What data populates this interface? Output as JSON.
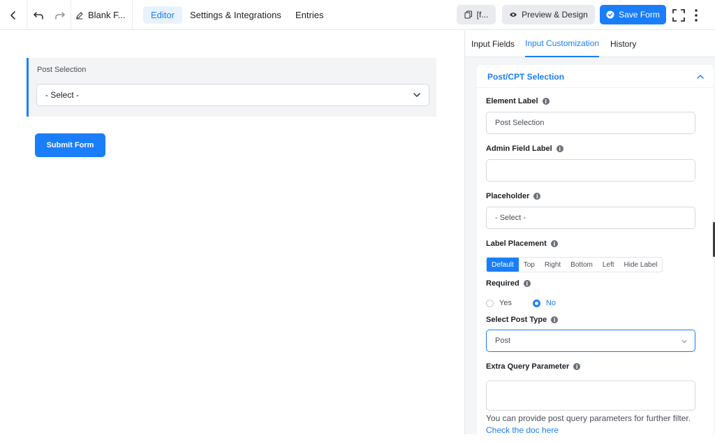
{
  "topbar": {
    "form_title": "Blank F...",
    "tabs": [
      {
        "label": "Editor",
        "active": true
      },
      {
        "label": "Settings & Integrations",
        "active": false
      },
      {
        "label": "Entries",
        "active": false
      }
    ],
    "shortcode_label": "[f...",
    "preview_label": "Preview & Design",
    "save_label": "Save Form",
    "icons": [
      "chevron-left-icon",
      "undo-icon",
      "redo-icon",
      "pencil-icon",
      "copy-icon",
      "eye-icon",
      "check-circle-icon",
      "fullscreen-icon",
      "more-vertical-icon"
    ]
  },
  "canvas": {
    "field_label": "Post Selection",
    "select_value": "- Select -",
    "submit_label": "Submit Form"
  },
  "sidebar": {
    "tabs": [
      {
        "label": "Input Fields",
        "active": false
      },
      {
        "label": "Input Customization",
        "active": true
      },
      {
        "label": "History",
        "active": false
      }
    ],
    "panel_title": "Post/CPT Selection",
    "element_label": {
      "label": "Element Label",
      "value": "Post Selection"
    },
    "admin_label": {
      "label": "Admin Field Label",
      "value": ""
    },
    "placeholder": {
      "label": "Placeholder",
      "value": "- Select -"
    },
    "label_placement": {
      "label": "Label Placement",
      "options": [
        "Default",
        "Top",
        "Right",
        "Bottom",
        "Left",
        "Hide Label"
      ],
      "selected": "Default"
    },
    "required": {
      "label": "Required",
      "options": [
        "Yes",
        "No"
      ],
      "selected": "No"
    },
    "post_type": {
      "label": "Select Post Type",
      "value": "Post"
    },
    "extra_query": {
      "label": "Extra Query Parameter",
      "value": "",
      "help": "You can provide post query parameters for further filter.",
      "link": "Check the doc here"
    }
  },
  "colors": {
    "accent": "#1a7efb",
    "sidebar_bg": "#f4f5f7",
    "field_bg": "#f3f4f6"
  }
}
